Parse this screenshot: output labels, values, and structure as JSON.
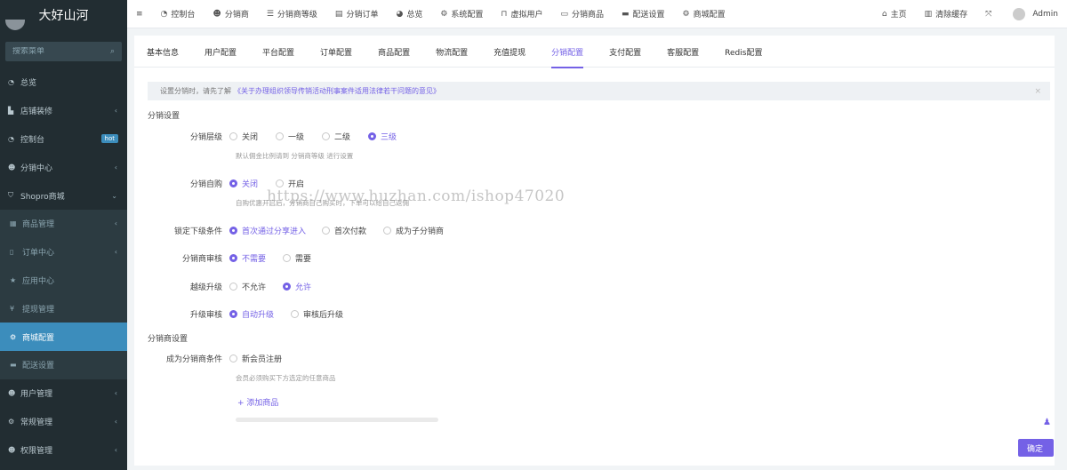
{
  "app": {
    "brand": "大好山河"
  },
  "search": {
    "placeholder": "搜索菜单"
  },
  "sidebar": {
    "items": [
      {
        "label": "总览",
        "icon": "dashboard-icon"
      },
      {
        "label": "店铺装修",
        "icon": "paint-icon",
        "has_children": true
      },
      {
        "label": "控制台",
        "icon": "dashboard-icon",
        "badge": "hot"
      },
      {
        "label": "分销中心",
        "icon": "users-icon",
        "has_children": true
      },
      {
        "label": "Shopro商城",
        "icon": "shield-icon",
        "expanded": true
      },
      {
        "label": "商品管理",
        "icon": "table-icon",
        "sub": true,
        "has_children": true
      },
      {
        "label": "订单中心",
        "icon": "file-icon",
        "sub": true,
        "has_children": true
      },
      {
        "label": "应用中心",
        "icon": "star-icon",
        "sub": true
      },
      {
        "label": "提现管理",
        "icon": "yen-icon",
        "sub": true
      },
      {
        "label": "商城配置",
        "icon": "cogs-icon",
        "sub": true,
        "active": true
      },
      {
        "label": "配送设置",
        "icon": "truck-icon",
        "sub": true
      },
      {
        "label": "用户管理",
        "icon": "user-icon",
        "has_children": true
      },
      {
        "label": "常规管理",
        "icon": "cogs-icon",
        "has_children": true
      },
      {
        "label": "权限管理",
        "icon": "group-icon",
        "has_children": true
      }
    ]
  },
  "topbar": {
    "menu_icon": "≡",
    "items": [
      {
        "label": "控制台",
        "icon": "dashboard-icon"
      },
      {
        "label": "分销商",
        "icon": "user-icon"
      },
      {
        "label": "分销商等级",
        "icon": "list-icon"
      },
      {
        "label": "分销订单",
        "icon": "file-icon"
      },
      {
        "label": "总览",
        "icon": "pie-icon"
      },
      {
        "label": "系统配置",
        "icon": "gear-icon"
      },
      {
        "label": "虚拟用户",
        "icon": "lock-icon"
      },
      {
        "label": "分销商品",
        "icon": "shopping-icon"
      },
      {
        "label": "配送设置",
        "icon": "truck-icon"
      },
      {
        "label": "商城配置",
        "icon": "cogs-icon"
      }
    ],
    "right": {
      "home": "主页",
      "clear_cache": "清除缓存",
      "user": "Admin"
    }
  },
  "tabs": [
    {
      "label": "基本信息"
    },
    {
      "label": "用户配置"
    },
    {
      "label": "平台配置"
    },
    {
      "label": "订单配置"
    },
    {
      "label": "商品配置"
    },
    {
      "label": "物流配置"
    },
    {
      "label": "充值提现"
    },
    {
      "label": "分销配置",
      "active": true
    },
    {
      "label": "支付配置"
    },
    {
      "label": "客服配置"
    },
    {
      "label": "Redis配置"
    }
  ],
  "alert": {
    "text": "设置分销时，请先了解",
    "link": "《关于办理组织领导传销活动刑事案件适用法律若干问题的意见》"
  },
  "sections": {
    "distribution": "分销设置",
    "distributor": "分销商设置"
  },
  "form": {
    "level": {
      "label": "分销层级",
      "options": [
        "关闭",
        "一级",
        "二级",
        "三级"
      ],
      "selected": 3,
      "hint": "默认佣金比例请到 分销商等级 进行设置"
    },
    "self_buy": {
      "label": "分销自购",
      "options": [
        "关闭",
        "开启"
      ],
      "selected": 0,
      "hint": "自购优惠开启后，分销商自己购买时，下单可以给自己返佣"
    },
    "lock": {
      "label": "锁定下级条件",
      "options": [
        "首次通过分享进入",
        "首次付款",
        "成为子分销商"
      ],
      "selected": 0
    },
    "review": {
      "label": "分销商审核",
      "options": [
        "不需要",
        "需要"
      ],
      "selected": 0
    },
    "upgrade_skip": {
      "label": "越级升级",
      "options": [
        "不允许",
        "允许"
      ],
      "selected": 1
    },
    "upgrade_review": {
      "label": "升级审核",
      "options": [
        "自动升级",
        "审核后升级"
      ],
      "selected": 0
    },
    "become": {
      "label": "成为分销商条件",
      "options": [
        "新会员注册"
      ],
      "selected": -1,
      "hint": "会员必须购买下方选定的任意商品",
      "add_goods": "+ 添加商品"
    }
  },
  "watermark": "https://www.huzhan.com/ishop47020",
  "confirm_button": "确定",
  "colors": {
    "accent": "#7461e6",
    "sidebar_bg": "#222d32",
    "sidebar_active": "#3c8dbc"
  }
}
